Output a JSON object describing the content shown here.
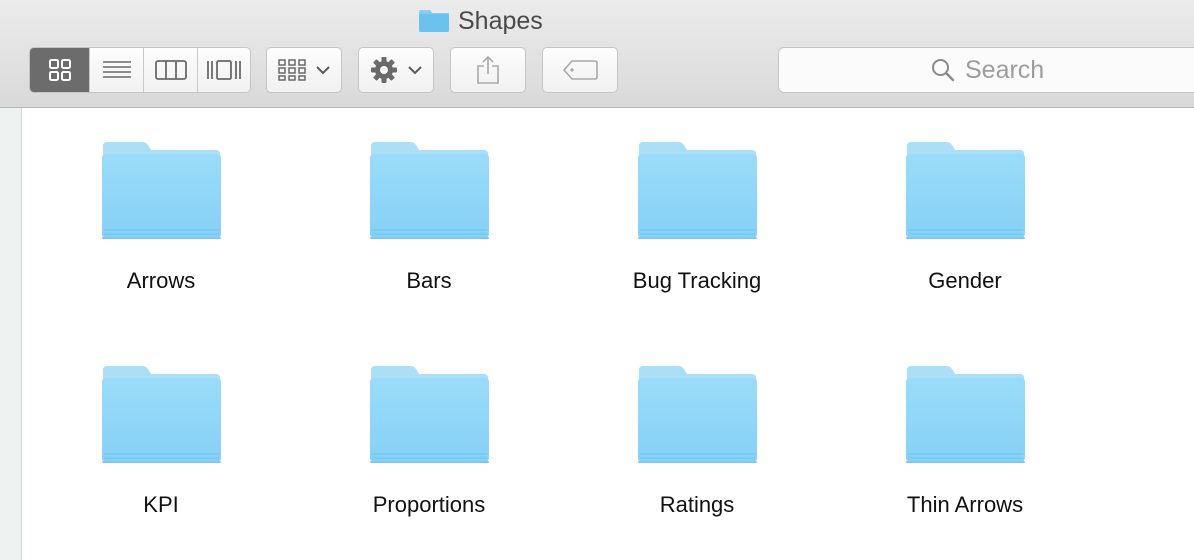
{
  "window": {
    "title": "Shapes"
  },
  "toolbar": {
    "view_modes": [
      {
        "name": "icon-view",
        "active": true
      },
      {
        "name": "list-view",
        "active": false
      },
      {
        "name": "column-view",
        "active": false
      },
      {
        "name": "cover-flow-view",
        "active": false
      }
    ],
    "icons": {
      "arrange": "arrange-grid-icon",
      "action": "gear-icon",
      "share": "share-icon",
      "tags": "tag-icon",
      "search": "search-icon"
    }
  },
  "search": {
    "placeholder": "Search"
  },
  "folders": [
    {
      "name": "Arrows"
    },
    {
      "name": "Bars"
    },
    {
      "name": "Bug Tracking"
    },
    {
      "name": "Gender"
    },
    {
      "name": "KPI"
    },
    {
      "name": "Proportions"
    },
    {
      "name": "Ratings"
    },
    {
      "name": "Thin Arrows"
    }
  ],
  "colors": {
    "folder_top": "#a9ddf7",
    "folder_body": "#8fd7f8",
    "active_segment": "#6c6c6c"
  }
}
